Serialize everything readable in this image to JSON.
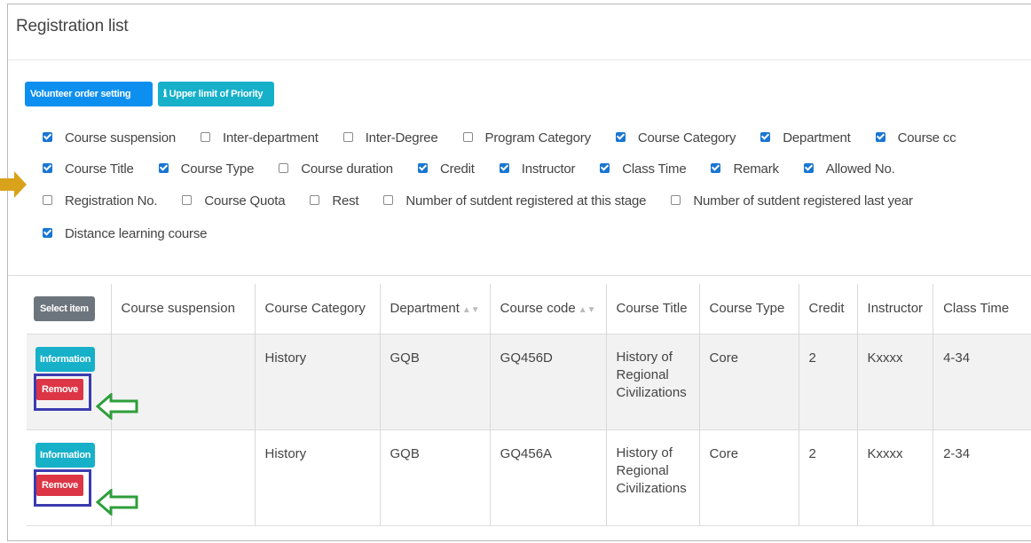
{
  "title": "Registration list",
  "buttons": {
    "volunteer": "Volunteer order setting",
    "upper_limit": "Upper limit of Priority",
    "upper_limit_icon": "info-icon"
  },
  "filters": [
    [
      {
        "label": "Course suspension",
        "checked": true
      },
      {
        "label": "Inter-department",
        "checked": false
      },
      {
        "label": "Inter-Degree",
        "checked": false
      },
      {
        "label": "Program Category",
        "checked": false
      },
      {
        "label": "Course Category",
        "checked": true
      },
      {
        "label": "Department",
        "checked": true
      },
      {
        "label": "Course cc",
        "checked": true
      }
    ],
    [
      {
        "label": "Course Title",
        "checked": true
      },
      {
        "label": "Course Type",
        "checked": true
      },
      {
        "label": "Course duration",
        "checked": false
      },
      {
        "label": "Credit",
        "checked": true
      },
      {
        "label": "Instructor",
        "checked": true
      },
      {
        "label": "Class Time",
        "checked": true
      },
      {
        "label": "Remark",
        "checked": true
      },
      {
        "label": "Allowed No.",
        "checked": true
      }
    ],
    [
      {
        "label": "Registration No.",
        "checked": false
      },
      {
        "label": "Course Quota",
        "checked": false
      },
      {
        "label": "Rest",
        "checked": false
      },
      {
        "label": "Number of sutdent registered at this stage",
        "checked": false
      },
      {
        "label": "Number of sutdent registered last year",
        "checked": false
      }
    ],
    [
      {
        "label": "Distance learning course",
        "checked": true
      }
    ]
  ],
  "table": {
    "select_label": "Select item",
    "headers": {
      "suspension": "Course suspension",
      "category": "Course Category",
      "department": "Department",
      "code": "Course code",
      "title": "Course Title",
      "type": "Course Type",
      "credit": "Credit",
      "instructor": "Instructor",
      "time": "Class Time"
    },
    "rows": [
      {
        "info": "Information",
        "remove": "Remove",
        "suspension": "",
        "category": "History",
        "department": "GQB",
        "code": "GQ456D",
        "title": "History of Regional Civilizations",
        "type": "Core",
        "credit": "2",
        "instructor": "Kxxxx",
        "time": "4-34"
      },
      {
        "info": "Information",
        "remove": "Remove",
        "suspension": "",
        "category": "History",
        "department": "GQB",
        "code": "GQ456A",
        "title": "History of Regional Civilizations",
        "type": "Core",
        "credit": "2",
        "instructor": "Kxxxx",
        "time": "2-34"
      }
    ]
  },
  "colors": {
    "primary": "#0d8ff0",
    "info": "#16b0c9",
    "danger": "#dc3545",
    "secondary": "#6c757d",
    "annotation_box": "#3b3bb0",
    "annotation_arrow_green": "#2e9e3a",
    "annotation_arrow_orange": "#d9a21b"
  }
}
